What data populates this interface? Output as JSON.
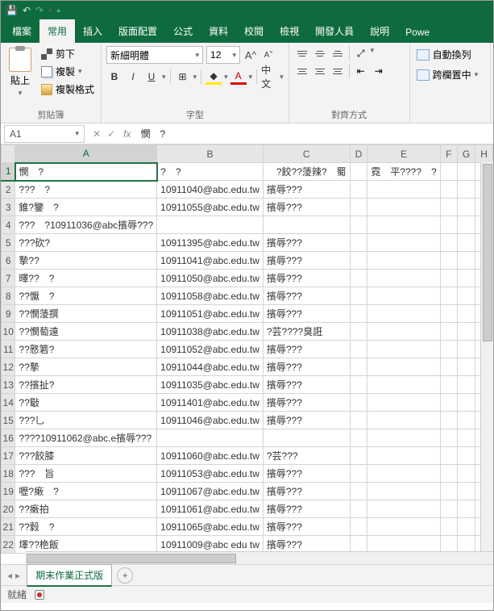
{
  "qat": {
    "save": "💾",
    "undo": "↶",
    "redo": "↷"
  },
  "tabs": {
    "file": "檔案",
    "home": "常用",
    "insert": "插入",
    "layout": "版面配置",
    "formula": "公式",
    "data": "資料",
    "review": "校閱",
    "view": "檢視",
    "developer": "開發人員",
    "help": "說明",
    "power": "Powe"
  },
  "clipboard": {
    "paste": "貼上",
    "cut": "剪下",
    "copy": "複製",
    "format": "複製格式",
    "label": "剪貼簿"
  },
  "font": {
    "name": "新細明體",
    "size": "12",
    "bold": "B",
    "italic": "I",
    "underline": "U",
    "phonetic": "中文",
    "label": "字型",
    "growA": "A",
    "shrinkA": "A"
  },
  "align": {
    "wrap": "自動換列",
    "merge": "跨欄置中",
    "label": "對齊方式"
  },
  "namebox": "A1",
  "formula_bar": "憫　?",
  "columns": [
    "A",
    "B",
    "C",
    "D",
    "E",
    "F",
    "G",
    "H"
  ],
  "rows": [
    {
      "n": "1",
      "c": [
        "憫　?",
        "?　?",
        "　?餃??蔆辣?　蜀",
        "",
        "霓　平????　?",
        "",
        "",
        ""
      ]
    },
    {
      "n": "2",
      "c": [
        "???　?",
        "10911040@abc.edu.tw",
        "擯辱???",
        "",
        "",
        "",
        "",
        ""
      ]
    },
    {
      "n": "3",
      "c": [
        "錐?鑒　?",
        "10911055@abc.edu.tw",
        "擯辱???",
        "",
        "",
        "",
        "",
        ""
      ]
    },
    {
      "n": "4",
      "c": [
        "???　?10911036@abc擯辱???",
        "",
        "",
        "",
        "",
        "",
        "",
        ""
      ]
    },
    {
      "n": "5",
      "c": [
        "???砍?",
        "10911395@abc.edu.tw",
        "擯辱???",
        "",
        "",
        "",
        "",
        ""
      ]
    },
    {
      "n": "6",
      "c": [
        "摯??",
        "10911041@abc.edu.tw",
        "擯辱???",
        "",
        "",
        "",
        "",
        ""
      ]
    },
    {
      "n": "7",
      "c": [
        "曎??　?",
        "10911050@abc.edu.tw",
        "擯辱???",
        "",
        "",
        "",
        "",
        ""
      ]
    },
    {
      "n": "8",
      "c": [
        "??懨　?",
        "10911058@abc.edu.tw",
        "擯辱???",
        "",
        "",
        "",
        "",
        ""
      ]
    },
    {
      "n": "9",
      "c": [
        "??憫蔆撰",
        "10911051@abc.edu.tw",
        "擯辱???",
        "",
        "",
        "",
        "",
        ""
      ]
    },
    {
      "n": "10",
      "c": [
        "??憫萄遠",
        "10911038@abc.edu.tw",
        "?芸????臭誑",
        "",
        "",
        "",
        "",
        ""
      ]
    },
    {
      "n": "11",
      "c": [
        "??憝箬?",
        "10911052@abc.edu.tw",
        "擯辱???",
        "",
        "",
        "",
        "",
        ""
      ]
    },
    {
      "n": "12",
      "c": [
        "??摯",
        "10911044@abc.edu.tw",
        "擯辱???",
        "",
        "",
        "",
        "",
        ""
      ]
    },
    {
      "n": "13",
      "c": [
        "??擯扯?",
        "10911035@abc.edu.tw",
        "擯辱???",
        "",
        "",
        "",
        "",
        ""
      ]
    },
    {
      "n": "14",
      "c": [
        "??斀",
        "10911401@abc.edu.tw",
        "擯辱???",
        "",
        "",
        "",
        "",
        ""
      ]
    },
    {
      "n": "15",
      "c": [
        "???乚",
        "10911046@abc.edu.tw",
        "擯辱???",
        "",
        "",
        "",
        "",
        ""
      ]
    },
    {
      "n": "16",
      "c": [
        "????10911062@abc.e擯辱???",
        "",
        "",
        "",
        "",
        "",
        "",
        ""
      ]
    },
    {
      "n": "17",
      "c": [
        "???餃膝",
        "10911060@abc.edu.tw",
        "?芸???",
        "",
        "",
        "",
        "",
        ""
      ]
    },
    {
      "n": "18",
      "c": [
        "???　旨",
        "10911053@abc.edu.tw",
        "擯辱???",
        "",
        "",
        "",
        "",
        ""
      ]
    },
    {
      "n": "19",
      "c": [
        "嚦?瘷　?",
        "10911067@abc.edu.tw",
        "擯辱???",
        "",
        "",
        "",
        "",
        ""
      ]
    },
    {
      "n": "20",
      "c": [
        "??瘷拍",
        "10911061@abc.edu.tw",
        "擯辱???",
        "",
        "",
        "",
        "",
        ""
      ]
    },
    {
      "n": "21",
      "c": [
        "??豰　?",
        "10911065@abc.edu.tw",
        "擯辱???",
        "",
        "",
        "",
        "",
        ""
      ]
    },
    {
      "n": "22",
      "c": [
        "墿??栬飯",
        "10911009@abc edu tw",
        "擯辱???",
        "",
        "",
        "",
        "",
        ""
      ]
    }
  ],
  "sheet": {
    "name": "期末作業正式版",
    "add": "+"
  },
  "status": {
    "ready": "就緒",
    "scroll": "▭"
  }
}
